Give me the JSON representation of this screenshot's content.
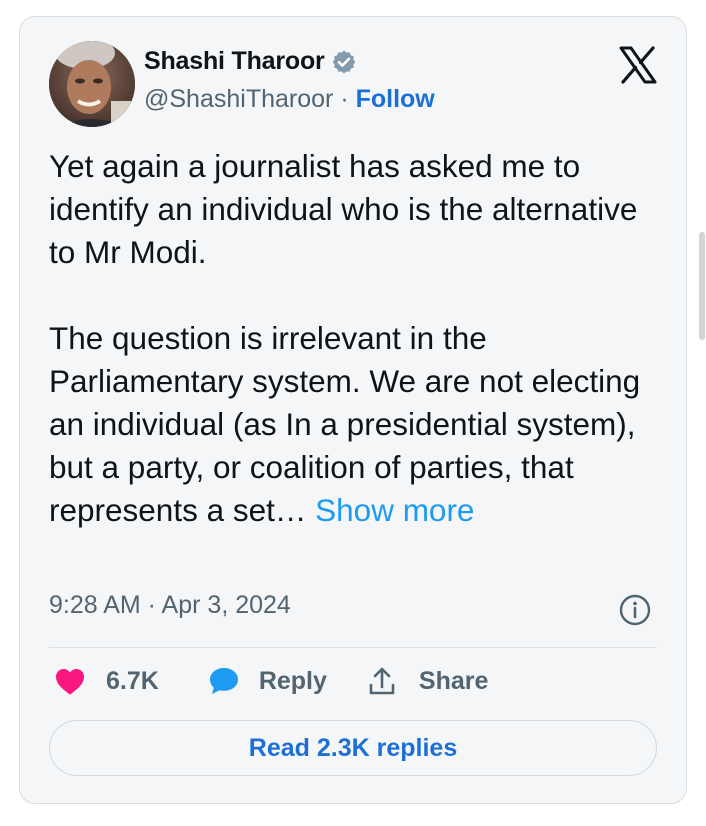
{
  "author": {
    "name": "Shashi Tharoor",
    "handle": "@ShashiTharoor",
    "separator": "·",
    "follow_label": "Follow",
    "verified_icon": "verified-badge-icon",
    "verified_color": "#829aab"
  },
  "brand": {
    "icon": "x-logo-icon"
  },
  "tweet": {
    "paragraph_1": "Yet again a journalist has asked me to identify an individual who is the alternative to Mr Modi.",
    "paragraph_2_truncated": "The question is irrelevant in the Parliamentary system. We are not electing an individual (as In a presidential system), but a party, or coalition of parties, that represents a set…",
    "show_more_label": "Show more",
    "timestamp": "9:28 AM · Apr 3, 2024"
  },
  "actions": {
    "like_count": "6.7K",
    "reply_label": "Reply",
    "share_label": "Share",
    "like_color": "#f91880",
    "reply_icon_color": "#1d9bf0"
  },
  "footer": {
    "read_replies_label": "Read 2.3K replies"
  },
  "colors": {
    "accent": "#1d9bf0",
    "link": "#1d6fd8",
    "text": "#0f1419",
    "muted": "#536471",
    "card_background": "#f4f6f8"
  }
}
